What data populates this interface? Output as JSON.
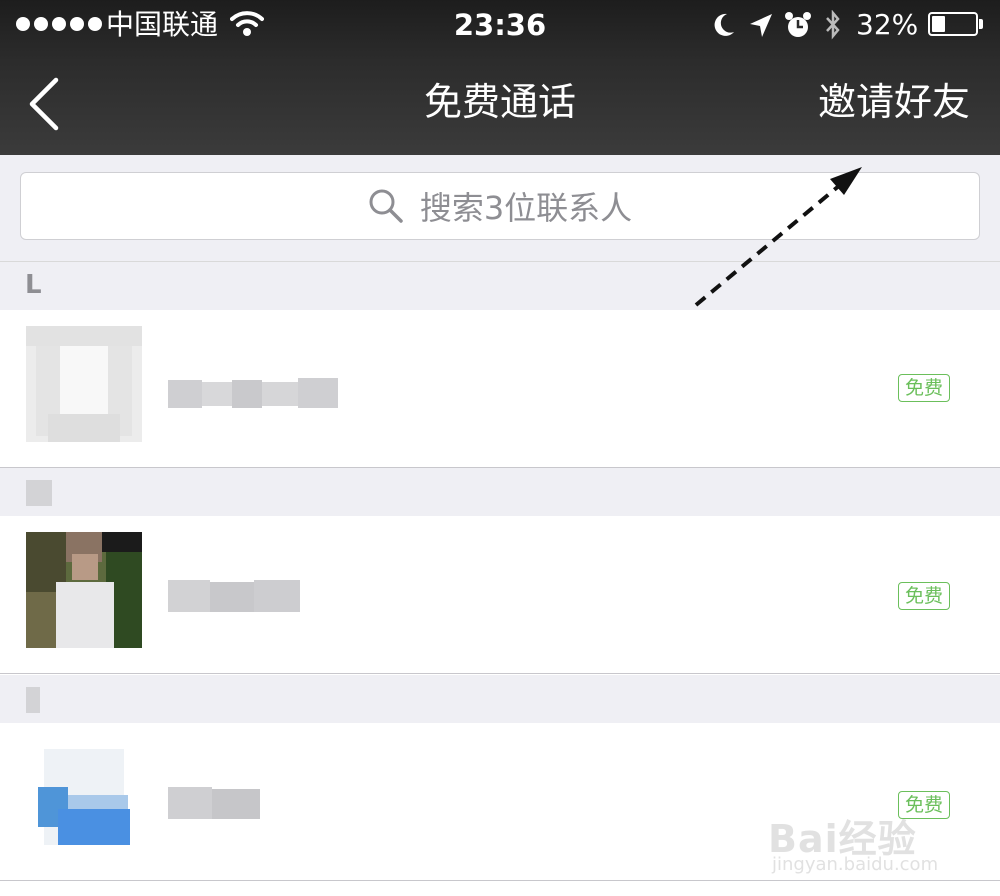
{
  "status_bar": {
    "carrier": "中国联通",
    "time": "23:36",
    "battery": "32%",
    "battery_level": 0.32,
    "icons": [
      "signal-dots-icon",
      "wifi-icon",
      "moon-icon",
      "location-arrow-icon",
      "alarm-icon",
      "bluetooth-icon",
      "battery-icon"
    ]
  },
  "nav": {
    "back_icon": "chevron-left-icon",
    "title": "免费通话",
    "invite_label": "邀请好友"
  },
  "search": {
    "placeholder": "搜索3位联系人",
    "icon": "search-icon"
  },
  "sections": [
    {
      "label": "L"
    },
    {
      "label": ""
    },
    {
      "label": ""
    }
  ],
  "contacts": [
    {
      "badge": "免费",
      "avatar": "default-avatar"
    },
    {
      "badge": "免费",
      "avatar": "photo-avatar"
    },
    {
      "badge": "免费",
      "avatar": "blue-avatar"
    }
  ],
  "watermark": {
    "text": "Bai经验",
    "url": "jingyan.baidu.com"
  },
  "colors": {
    "bar_dark": "#2c2c2c",
    "list_bg": "#efeff4",
    "badge_green": "#6bbf5b",
    "placeholder_gray": "#8e8e93"
  }
}
